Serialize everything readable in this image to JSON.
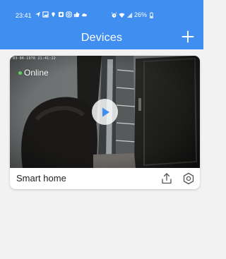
{
  "status_bar": {
    "time": "23:41",
    "battery": "26%"
  },
  "header": {
    "title": "Devices",
    "add_icon": "plus-icon"
  },
  "devices": [
    {
      "name": "Smart home",
      "status": "Online",
      "status_color": "#5bd35b",
      "timestamp": "03-06-1978 21:41:22",
      "actions": [
        "share-icon",
        "settings-icon"
      ]
    }
  ],
  "colors": {
    "accent": "#3f8ef0",
    "background": "#f2f2f2"
  }
}
